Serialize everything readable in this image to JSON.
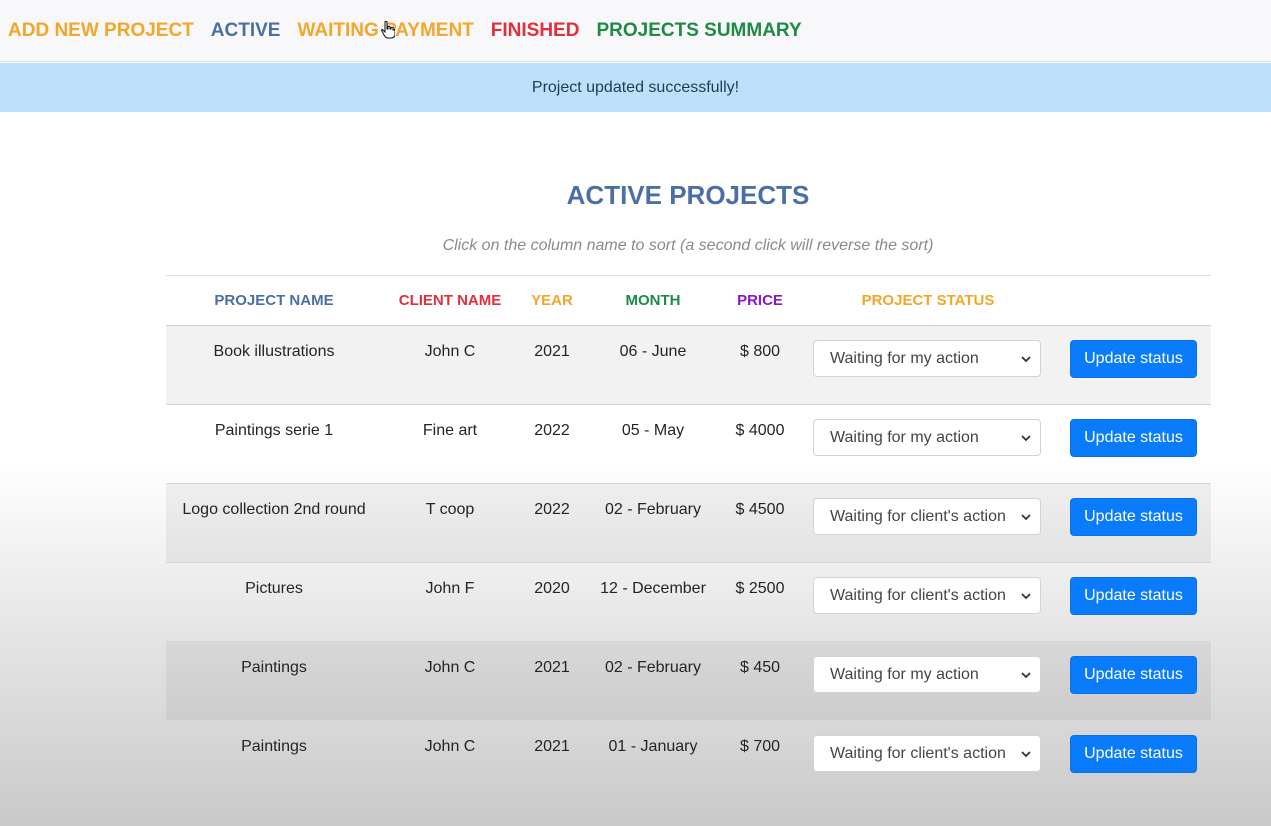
{
  "nav": {
    "items": [
      {
        "label": "ADD NEW PROJECT",
        "color": "#f4a62a"
      },
      {
        "label": "ACTIVE",
        "color": "#4a6fa5"
      },
      {
        "label": "WAITING PAYMENT",
        "color": "#f4a62a"
      },
      {
        "label": "FINISHED",
        "color": "#e0303c"
      },
      {
        "label": "PROJECTS SUMMARY",
        "color": "#1e8a46"
      }
    ]
  },
  "alert": {
    "message": "Project updated successfully!"
  },
  "page": {
    "title": "ACTIVE PROJECTS",
    "hint": "Click on the column name to sort (a second click will reverse the sort)"
  },
  "table": {
    "headers": [
      {
        "label": "PROJECT NAME",
        "color": "#4a6fa5"
      },
      {
        "label": "CLIENT NAME",
        "color": "#e0303c"
      },
      {
        "label": "YEAR",
        "color": "#f4a62a"
      },
      {
        "label": "MONTH",
        "color": "#1e8a46"
      },
      {
        "label": "PRICE",
        "color": "#8a17c4"
      },
      {
        "label": "PROJECT STATUS",
        "color": "#f4a62a"
      }
    ],
    "rows": [
      {
        "name": "Book illustrations",
        "client": "John C",
        "year": "2021",
        "month": "06 - June",
        "price": "$ 800",
        "status": "Waiting for my action",
        "button": "Update status"
      },
      {
        "name": "Paintings serie 1",
        "client": "Fine art",
        "year": "2022",
        "month": "05 - May",
        "price": "$ 4000",
        "status": "Waiting for my action",
        "button": "Update status"
      },
      {
        "name": "Logo collection 2nd round",
        "client": "T coop",
        "year": "2022",
        "month": "02 - February",
        "price": "$ 4500",
        "status": "Waiting for client's action",
        "button": "Update status"
      },
      {
        "name": "Pictures",
        "client": "John F",
        "year": "2020",
        "month": "12 - December",
        "price": "$ 2500",
        "status": "Waiting for client's action",
        "button": "Update status"
      },
      {
        "name": "Paintings",
        "client": "John C",
        "year": "2021",
        "month": "02 - February",
        "price": "$ 450",
        "status": "Waiting for my action",
        "button": "Update status"
      },
      {
        "name": "Paintings",
        "client": "John C",
        "year": "2021",
        "month": "01 - January",
        "price": "$ 700",
        "status": "Waiting for client's action",
        "button": "Update status"
      }
    ]
  },
  "colors": {
    "button": "#0a7bfb",
    "alert_bg": "#bfe0fb",
    "title": "#4a6fa5"
  },
  "icons": {
    "cursor": "hand-pointer-icon",
    "select_arrow": "chevron-down-icon"
  }
}
